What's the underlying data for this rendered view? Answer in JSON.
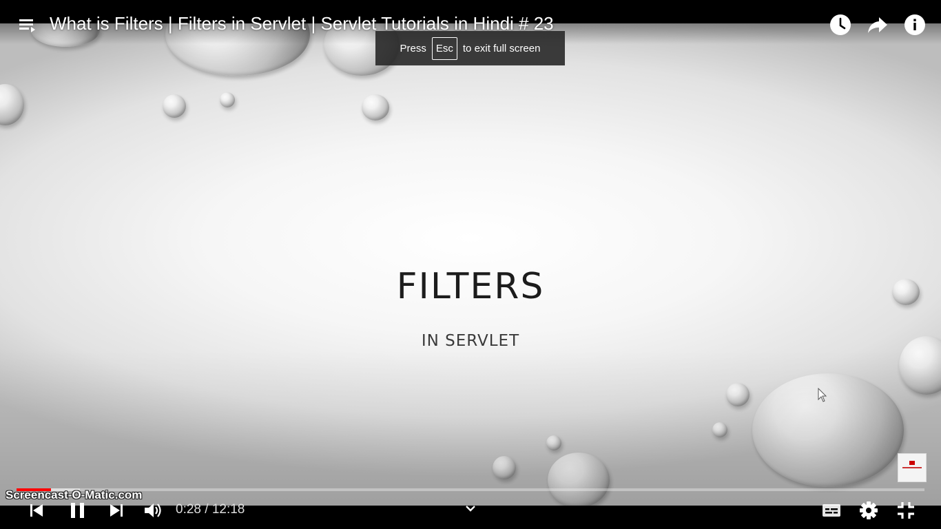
{
  "player": {
    "title": "What is Filters | Filters in Servlet | Servlet Tutorials in Hindi # 23",
    "esc_toast": {
      "prefix": "Press",
      "key": "Esc",
      "suffix": "to exit full screen"
    },
    "top_icons": [
      "playlist-icon",
      "watch-later-icon",
      "share-icon",
      "info-icon"
    ],
    "time": "0:28 / 12:18",
    "progress": {
      "played_fraction": 0.038,
      "loaded_fraction": 0.07
    },
    "control_icons": [
      "previous-icon",
      "pause-icon",
      "next-icon",
      "volume-icon",
      "chevron-down-icon",
      "subtitles-icon",
      "settings-icon",
      "exit-fullscreen-icon"
    ],
    "accent_color": "#ff0000"
  },
  "slide": {
    "title": "FILTERS",
    "subtitle": "IN SERVLET"
  },
  "watermark": "Screencast-O-Matic.com"
}
